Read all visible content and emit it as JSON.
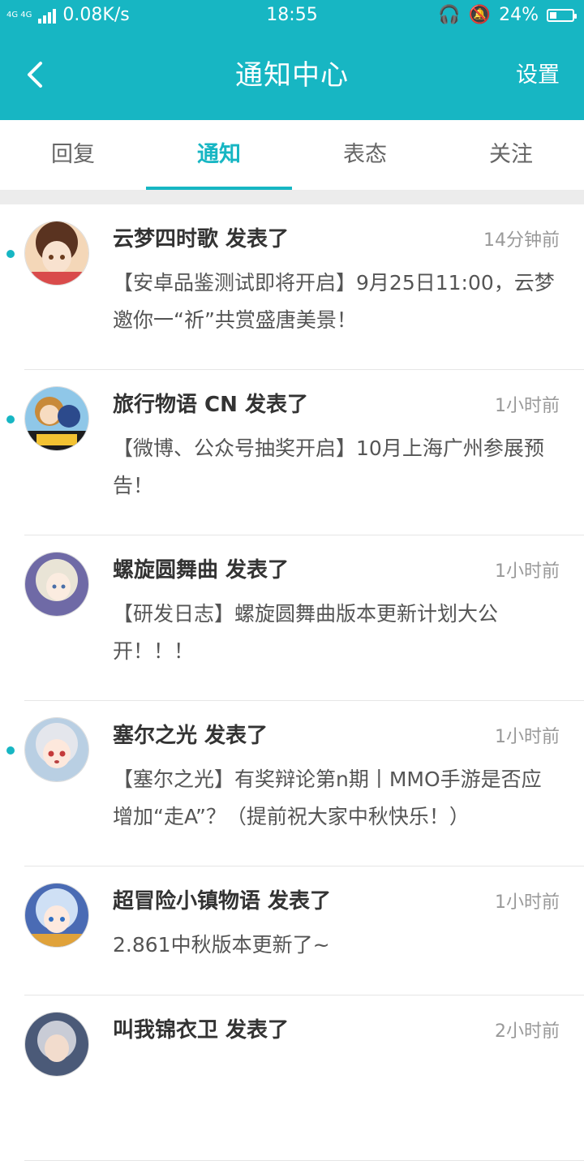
{
  "status_bar": {
    "network": "4G 4G",
    "speed": "0.08K/s",
    "time": "18:55",
    "battery": "24%"
  },
  "header": {
    "back_icon": "back-arrow-icon",
    "title": "通知中心",
    "settings": "设置"
  },
  "tabs": [
    {
      "label": "回复",
      "active": false
    },
    {
      "label": "通知",
      "active": true
    },
    {
      "label": "表态",
      "active": false
    },
    {
      "label": "关注",
      "active": false
    }
  ],
  "notifications": [
    {
      "name": "云梦四时歌 发表了",
      "time": "14分钟前",
      "content": "【安卓品鉴测试即将开启】9月25日11:00，云梦邀你一“祈”共赏盛唐美景！",
      "unread": true
    },
    {
      "name": "旅行物语 CN 发表了",
      "time": "1小时前",
      "content": "【微博、公众号抽奖开启】10月上海广州参展预告！",
      "unread": true
    },
    {
      "name": "螺旋圆舞曲 发表了",
      "time": "1小时前",
      "content": "【研发日志】螺旋圆舞曲版本更新计划大公开！！！",
      "unread": false
    },
    {
      "name": "塞尔之光 发表了",
      "time": "1小时前",
      "content": "【塞尔之光】有奖辩论第n期丨MMO手游是否应增加“走A”？（提前祝大家中秋快乐！）",
      "unread": true
    },
    {
      "name": "超冒险小镇物语 发表了",
      "time": "1小时前",
      "content": "2.861中秋版本更新了~",
      "unread": false
    },
    {
      "name": "叫我锦衣卫 发表了",
      "time": "2小时前",
      "content": "",
      "unread": false
    }
  ],
  "colors": {
    "accent": "#17b6c3",
    "divider": "#e6e6e6",
    "gap": "#ececec"
  }
}
